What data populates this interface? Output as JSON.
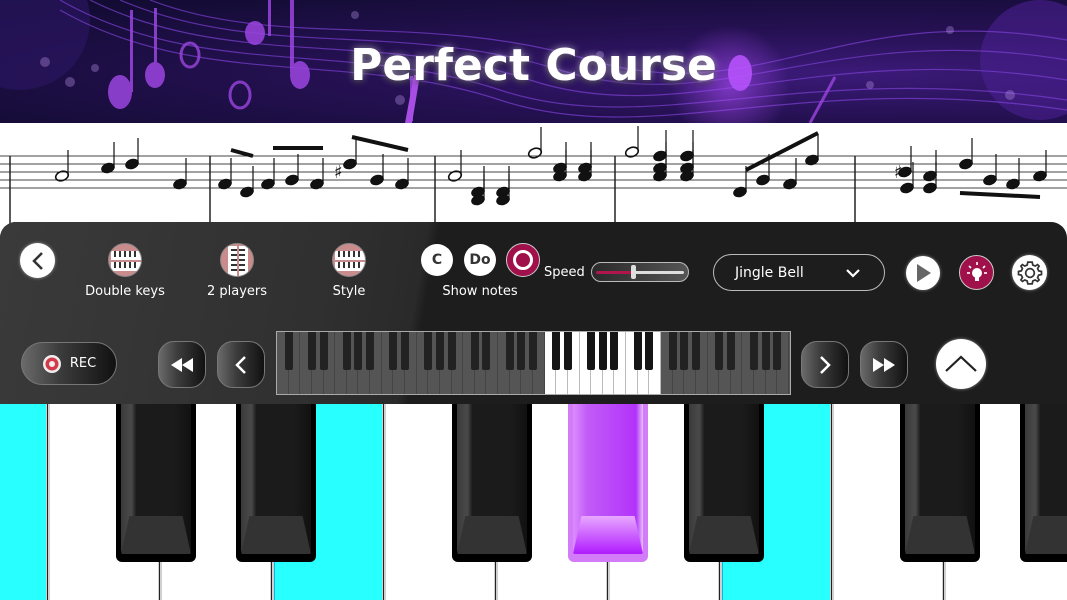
{
  "banner": {
    "title": "Perfect Course"
  },
  "toolbar": {
    "back_icon": "chevron-left-icon",
    "modes": [
      {
        "label": "Double keys",
        "icon": "double-keys-icon"
      },
      {
        "label": "2  players",
        "icon": "two-players-icon"
      },
      {
        "label": "Style",
        "icon": "keyboard-style-icon"
      }
    ],
    "show_notes": {
      "label": "Show notes",
      "options": [
        "C",
        "Do"
      ],
      "toggle_icon": "record-toggle-icon"
    },
    "speed": {
      "label": "Speed",
      "value": 0.42
    },
    "song_select": {
      "selected": "Jingle Bell"
    },
    "play_icon": "play-icon",
    "hint_icon": "lightbulb-icon",
    "settings_icon": "gear-icon",
    "accent_color": "#a0104a"
  },
  "navigation": {
    "rec_label": "REC",
    "rewind_icon": "rewind-icon",
    "prev_icon": "chevron-left-icon",
    "next_icon": "chevron-right-icon",
    "fast_forward_icon": "fast-forward-icon",
    "collapse_icon": "chevron-up-icon"
  },
  "mini_keyboard": {
    "start_note": "A",
    "white_key_count": 44,
    "visible_range_start_white_index": 23,
    "visible_range_white_count": 10
  },
  "keyboard": {
    "white_keys": [
      "B",
      "C",
      "D",
      "E",
      "F",
      "G",
      "A",
      "B",
      "C",
      "D"
    ],
    "black_keys": [
      "C#",
      "D#",
      "F#",
      "G#",
      "A#",
      "C#",
      "D#"
    ],
    "highlighted_white": [
      "E",
      "B"
    ],
    "highlighted_white_color": "#28ffff",
    "highlighted_black": [
      "G#"
    ],
    "highlighted_black_color": "#b233fb"
  }
}
